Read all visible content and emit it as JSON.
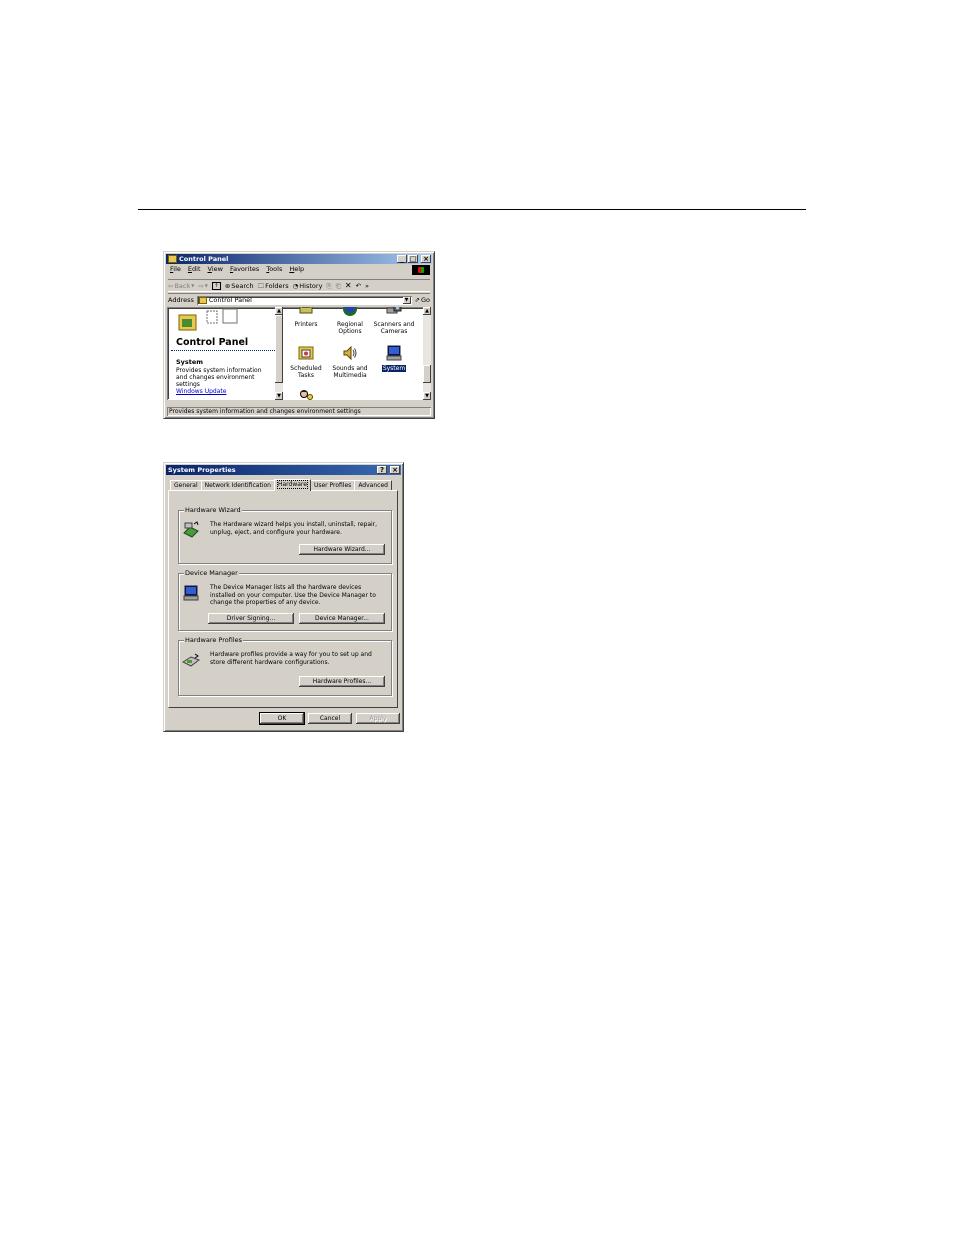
{
  "control_panel": {
    "title": "Control Panel",
    "menu": [
      "File",
      "Edit",
      "View",
      "Favorites",
      "Tools",
      "Help"
    ],
    "toolbar": {
      "back": "Back",
      "search": "Search",
      "folders": "Folders",
      "history": "History",
      "more": "»"
    },
    "address": {
      "label": "Address",
      "value": "Control Panel",
      "go": "Go"
    },
    "left_pane": {
      "heading": "Control Panel",
      "selected_name": "System",
      "selected_desc": "Provides system information and changes environment settings",
      "link": "Windows Update"
    },
    "icons": [
      {
        "label": "Printers"
      },
      {
        "label": "Regional Options"
      },
      {
        "label": "Scanners and Cameras"
      },
      {
        "label": "Scheduled Tasks"
      },
      {
        "label": "Sounds and Multimedia"
      },
      {
        "label": "System",
        "selected": true
      }
    ],
    "status": "Provides system information and changes environment settings"
  },
  "system_properties": {
    "title": "System Properties",
    "title_buttons": {
      "help": "?",
      "close": "×"
    },
    "tabs": [
      "General",
      "Network Identification",
      "Hardware",
      "User Profiles",
      "Advanced"
    ],
    "active_tab": "Hardware",
    "groups": {
      "wizard": {
        "title": "Hardware Wizard",
        "desc": "The Hardware wizard helps you install, uninstall, repair, unplug, eject, and configure your hardware.",
        "button": "Hardware Wizard..."
      },
      "device_manager": {
        "title": "Device Manager",
        "desc": "The Device Manager lists all the hardware devices installed on your computer. Use the Device Manager to change the properties of any device.",
        "button_signing": "Driver Signing...",
        "button_dm": "Device Manager..."
      },
      "profiles": {
        "title": "Hardware Profiles",
        "desc": "Hardware profiles provide a way for you to set up and store different hardware configurations.",
        "button": "Hardware Profiles..."
      }
    },
    "buttons": {
      "ok": "OK",
      "cancel": "Cancel",
      "apply": "Apply"
    }
  },
  "colors": {
    "titlebar": "#0a246a",
    "face": "#d4d0c8",
    "link": "#0000cc"
  }
}
